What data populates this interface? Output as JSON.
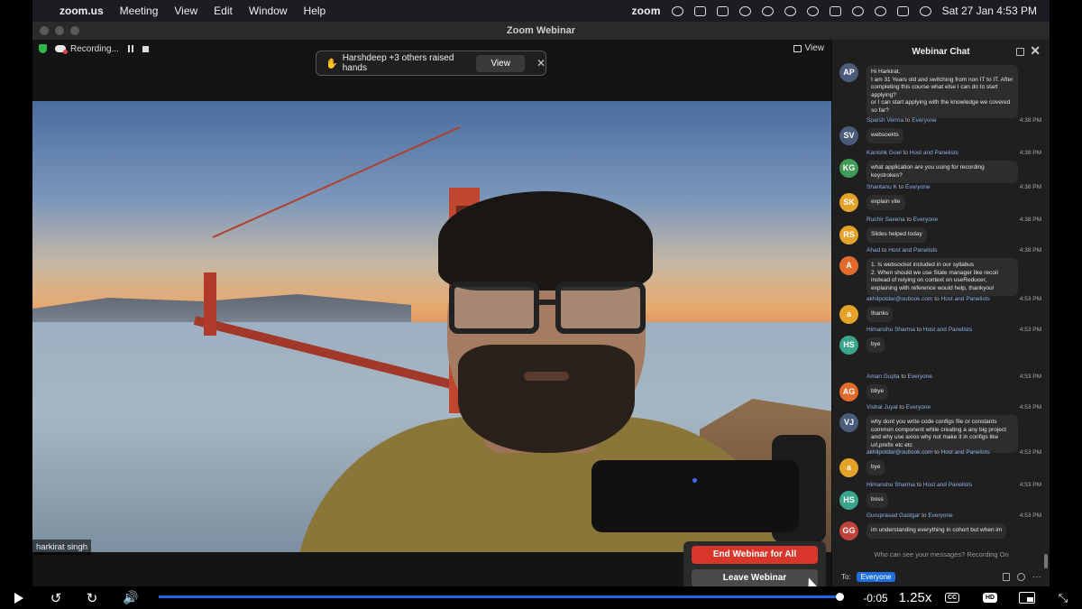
{
  "menubar": {
    "app_name": "zoom.us",
    "menus": [
      "Meeting",
      "View",
      "Edit",
      "Window",
      "Help"
    ],
    "zoom_badge": "zoom",
    "datetime": "Sat 27 Jan  4:53 PM"
  },
  "window": {
    "title": "Zoom Webinar"
  },
  "toolbar": {
    "recording_label": "Recording...",
    "view_label": "View"
  },
  "raise_banner": {
    "text": "Harshdeep +3 others raised hands",
    "view_label": "View"
  },
  "video": {
    "participant_name": "harkirat singh"
  },
  "end_menu": {
    "end_all_label": "End Webinar for All",
    "leave_label": "Leave Webinar"
  },
  "chat": {
    "title": "Webinar Chat",
    "messages": [
      {
        "initials": "AP",
        "color": "#4b5c7a",
        "sender": "",
        "to": "",
        "target": "",
        "time": "",
        "text": "Hi Harkirat,\nI am 31 Years old and switching from non IT to IT. After completing this course what else I can do to start applying?\nor I can start applying with the knowledge we covered so far?"
      },
      {
        "initials": "SV",
        "color": "#4b5c7a",
        "sender": "Sparsh Verma",
        "to": "to",
        "target": "Everyone",
        "time": "4:38 PM",
        "text": "websoekts"
      },
      {
        "initials": "KG",
        "color": "#3f9a55",
        "sender": "Kanishk Goel",
        "to": "to",
        "target": "Host and Panelists",
        "time": "4:38 PM",
        "text": "what application are you using for recording keystrokes?"
      },
      {
        "initials": "SK",
        "color": "#e5a229",
        "sender": "Shantanu K",
        "to": "to",
        "target": "Everyone",
        "time": "4:38 PM",
        "text": "explain vite"
      },
      {
        "initials": "RS",
        "color": "#e5a229",
        "sender": "Ruchir Saxena",
        "to": "to",
        "target": "Everyone",
        "time": "4:38 PM",
        "text": "Slides helped today"
      },
      {
        "initials": "A",
        "color": "#e06b2a",
        "sender": "Ahad",
        "to": "to",
        "target": "Host and Panelists",
        "time": "4:38 PM",
        "text": "1. Is websocket included in our syllabus\n2. When should we use State manager like recoil instead of relying on context on useReducer, explaining with reference would help, thankyou!"
      },
      {
        "initials": "a",
        "color": "#e5a229",
        "sender": "akhilpotdar@outlook.com",
        "to": "to",
        "target": "Host and Panelists",
        "time": "4:53 PM",
        "text": "thanks"
      },
      {
        "initials": "HS",
        "color": "#3aa58a",
        "sender": "Himanshu Sharma",
        "to": "to",
        "target": "Host and Panelists",
        "time": "4:53 PM",
        "text": "bye"
      },
      {
        "initials": "AG",
        "color": "#e06b2a",
        "sender": "Aman Gupta",
        "to": "to",
        "target": "Everyone",
        "time": "4:53 PM",
        "text": "bbye"
      },
      {
        "initials": "VJ",
        "color": "#4b5c7a",
        "sender": "Vishal Juyal",
        "to": "to",
        "target": "Everyone",
        "time": "4:53 PM",
        "text": "why dont you write code configs file or constants common component while creating a any big project and why use axios why not make it in configs like url,prefix etc etc"
      },
      {
        "initials": "a",
        "color": "#e5a229",
        "sender": "akhilpotdar@outlook.com",
        "to": "to",
        "target": "Host and Panelists",
        "time": "4:53 PM",
        "text": "bye"
      },
      {
        "initials": "HS",
        "color": "#3aa58a",
        "sender": "Himanshu Sharma",
        "to": "to",
        "target": "Host and Panelists",
        "time": "4:53 PM",
        "text": "boss"
      },
      {
        "initials": "GG",
        "color": "#c0423a",
        "sender": "Guruprasad Gastgar",
        "to": "to",
        "target": "Everyone",
        "time": "4:53 PM",
        "text": "im understanding everything in cohort but when im"
      }
    ],
    "privacy_note": "Who can see your messages? Recording On",
    "to_label": "To:",
    "to_value": "Everyone"
  },
  "player": {
    "progress": 0.995,
    "remaining": "-0:05",
    "speed": "1.25x",
    "cc_label": "CC",
    "hd_label": "HD"
  }
}
